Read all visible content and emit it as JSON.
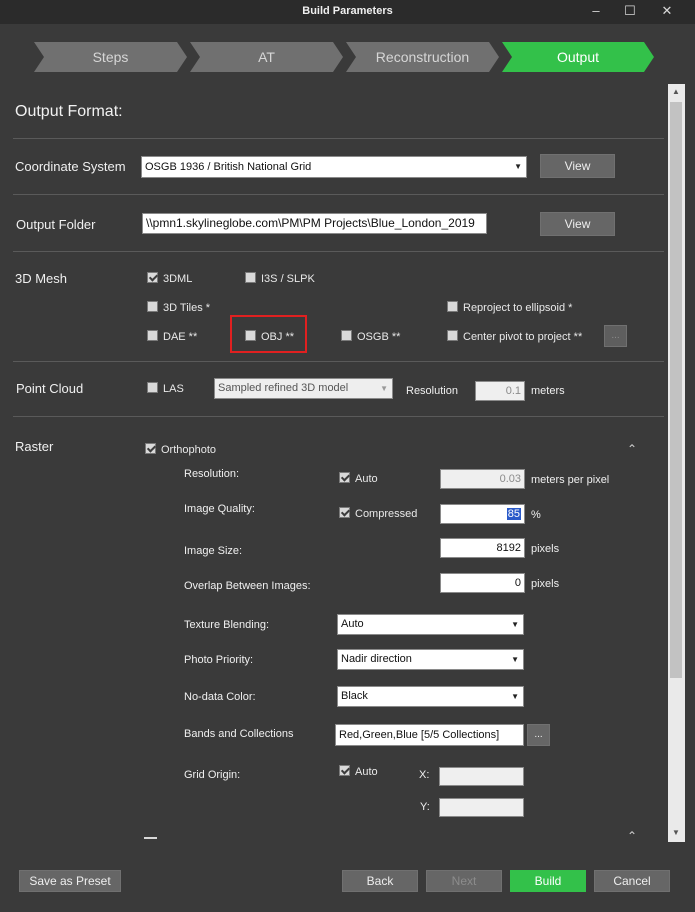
{
  "window": {
    "title": "Build Parameters",
    "min": "–",
    "max": "☐",
    "close": "✕"
  },
  "steps": [
    "Steps",
    "AT",
    "Reconstruction",
    "Output"
  ],
  "panel_title": "Output Format:",
  "coordinate": {
    "label": "Coordinate System",
    "value": "OSGB 1936 / British National Grid",
    "view": "View"
  },
  "output_folder": {
    "label": "Output Folder",
    "value": "\\\\pmn1.skylineglobe.com\\PM\\PM Projects\\Blue_London_2019",
    "view": "View"
  },
  "mesh": {
    "label": "3D Mesh",
    "options": {
      "d3dml": "3DML",
      "i3s": "I3S / SLPK",
      "tiles": "3D Tiles *",
      "dae": "DAE **",
      "obj": "OBJ **",
      "osgb": "OSGB **",
      "reproject": "Reproject to ellipsoid *",
      "center": "Center pivot to project **"
    },
    "more": "..."
  },
  "point_cloud": {
    "label": "Point Cloud",
    "las": "LAS",
    "source": "Sampled refined 3D model",
    "resolution_label": "Resolution",
    "resolution": "0.1",
    "unit": "meters"
  },
  "raster": {
    "label": "Raster",
    "ortho": "Orthophoto",
    "resolution": {
      "label": "Resolution:",
      "auto": "Auto",
      "value": "0.03",
      "unit": "meters per pixel"
    },
    "quality": {
      "label": "Image Quality:",
      "compressed": "Compressed",
      "value": "85",
      "unit": "%"
    },
    "size": {
      "label": "Image Size:",
      "value": "8192",
      "unit": "pixels"
    },
    "overlap": {
      "label": "Overlap Between Images:",
      "value": "0",
      "unit": "pixels"
    },
    "blending": {
      "label": "Texture Blending:",
      "value": "Auto"
    },
    "priority": {
      "label": "Photo Priority:",
      "value": "Nadir direction"
    },
    "nodata": {
      "label": "No-data Color:",
      "value": "Black"
    },
    "bands": {
      "label": "Bands and Collections",
      "value": "Red,Green,Blue [5/5 Collections]",
      "more": "..."
    },
    "grid": {
      "label": "Grid Origin:",
      "auto": "Auto",
      "x": "X:",
      "y": "Y:"
    }
  },
  "footer": {
    "preset": "Save as Preset",
    "back": "Back",
    "next": "Next",
    "build": "Build",
    "cancel": "Cancel"
  }
}
